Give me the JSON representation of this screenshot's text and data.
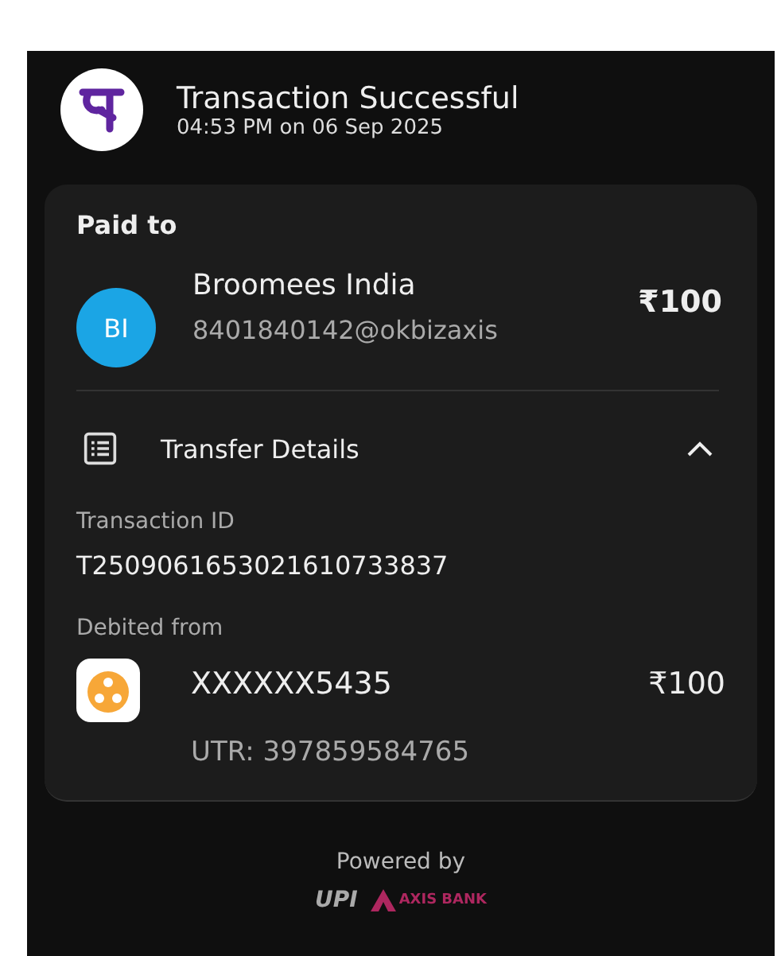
{
  "header": {
    "title": "Transaction Successful",
    "timestamp": "04:53 PM on 06 Sep 2025"
  },
  "paid_to": {
    "heading": "Paid to",
    "initials": "BI",
    "name": "Broomees India",
    "upi_id": "8401840142@okbizaxis",
    "amount": "₹100"
  },
  "transfer_details": {
    "title": "Transfer Details",
    "expanded": true,
    "fields": [
      {
        "label": "Transaction ID",
        "value": "T2509061653021610733837"
      }
    ],
    "debited_from": {
      "label": "Debited from",
      "account": "XXXXXX5435",
      "amount": "₹100",
      "utr": "UTR: 397859584765"
    }
  },
  "footer": {
    "powered_by": "Powered by",
    "logos": [
      "UPI",
      "AXIS BANK"
    ]
  }
}
